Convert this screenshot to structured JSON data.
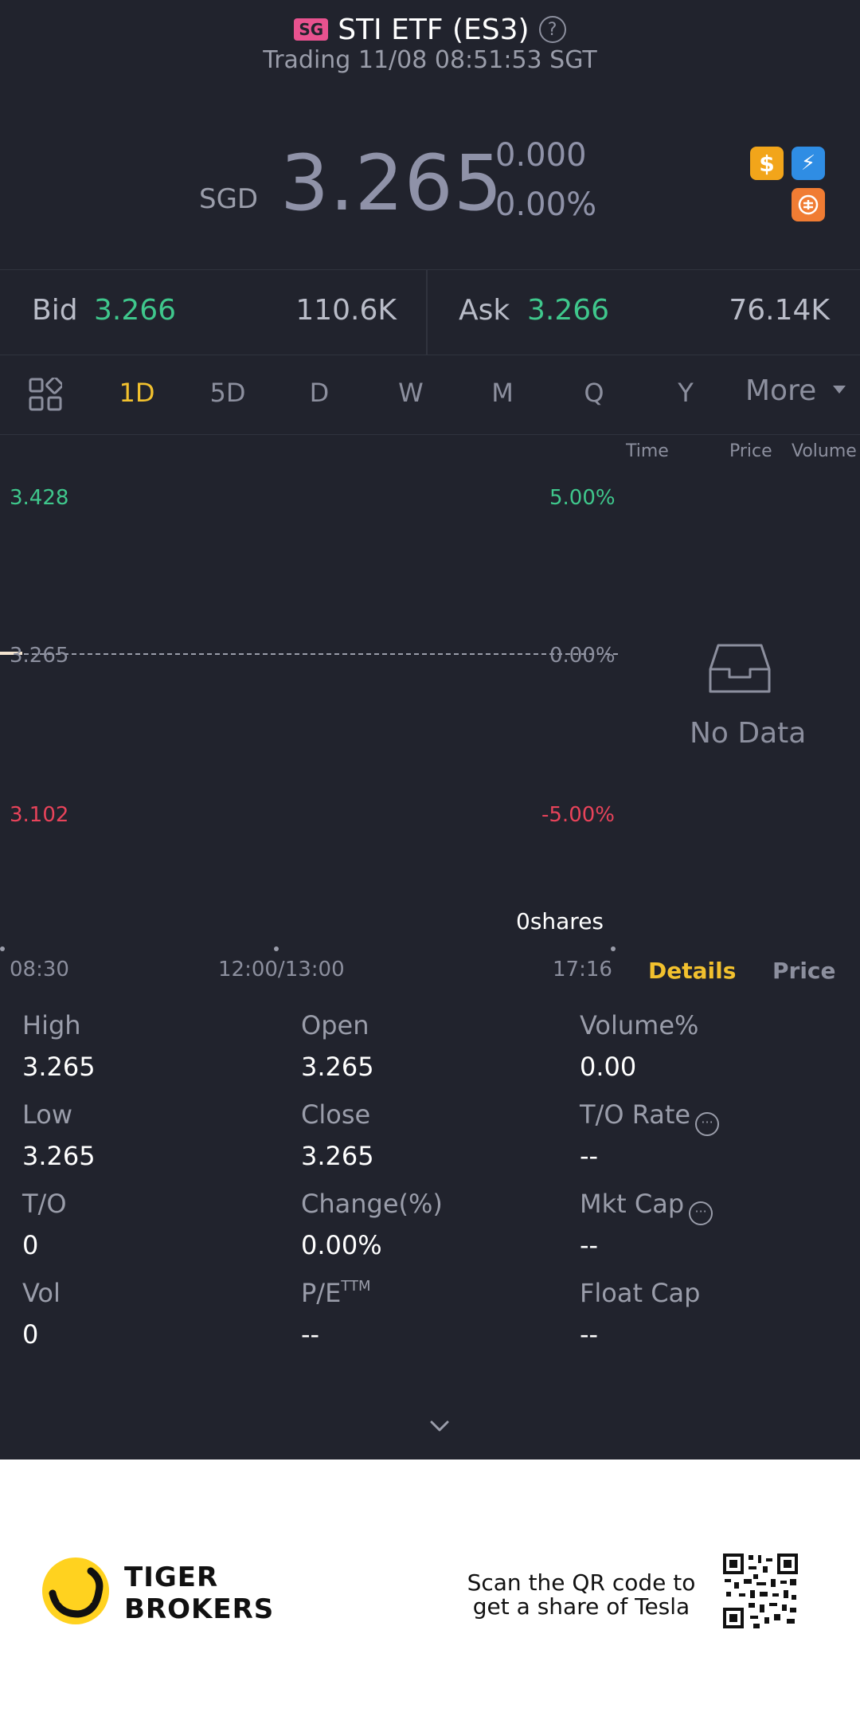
{
  "header": {
    "region_badge": "SG",
    "title": "STI ETF (ES3)",
    "help_glyph": "?",
    "status": "Trading 11/08 08:51:53 SGT"
  },
  "quote": {
    "currency": "SGD",
    "last_price": "3.265",
    "change_abs": "0.000",
    "change_pct": "0.00%",
    "icons": [
      "dollar-icon",
      "flash-icon",
      "margin-icon"
    ]
  },
  "bidask": {
    "bid_label": "Bid",
    "bid_price": "3.266",
    "bid_size": "110.6K",
    "ask_label": "Ask",
    "ask_price": "3.266",
    "ask_size": "76.14K"
  },
  "tabs": {
    "items": [
      "1D",
      "5D",
      "D",
      "W",
      "M",
      "Q",
      "Y"
    ],
    "active": "1D",
    "more": "More"
  },
  "chart": {
    "y_high": "3.428",
    "y_mid": "3.265",
    "y_low": "3.102",
    "pct_high": "5.00%",
    "pct_mid": "0.00%",
    "pct_low": "-5.00%",
    "volume_label": "0shares",
    "time_start": "08:30",
    "time_mid": "12:00/13:00",
    "time_end": "17:16"
  },
  "trades_panel": {
    "col_time": "Time",
    "col_price": "Price",
    "col_volume": "Volume",
    "empty_text": "No Data",
    "tab_details": "Details",
    "tab_price": "Price"
  },
  "stats": {
    "high_label": "High",
    "high_value": "3.265",
    "open_label": "Open",
    "open_value": "3.265",
    "volpct_label": "Volume%",
    "volpct_value": "0.00",
    "low_label": "Low",
    "low_value": "3.265",
    "close_label": "Close",
    "close_value": "3.265",
    "torate_label": "T/O Rate",
    "torate_value": "--",
    "to_label": "T/O",
    "to_value": "0",
    "change_label": "Change(%)",
    "change_value": "0.00%",
    "mktcap_label": "Mkt Cap",
    "mktcap_value": "--",
    "vol_label": "Vol",
    "vol_value": "0",
    "pe_label": "P/E",
    "pe_sup": "TTM",
    "pe_value": "--",
    "floatcap_label": "Float Cap",
    "floatcap_value": "--"
  },
  "footer": {
    "brand_line1": "TIGER",
    "brand_line2": "BROKERS",
    "qr_line1": "Scan the QR code to",
    "qr_line2": "get a share of Tesla"
  },
  "colors": {
    "background": "#21232d",
    "up": "#3fc78c",
    "down": "#e8435a",
    "accent": "#f2c12e"
  }
}
